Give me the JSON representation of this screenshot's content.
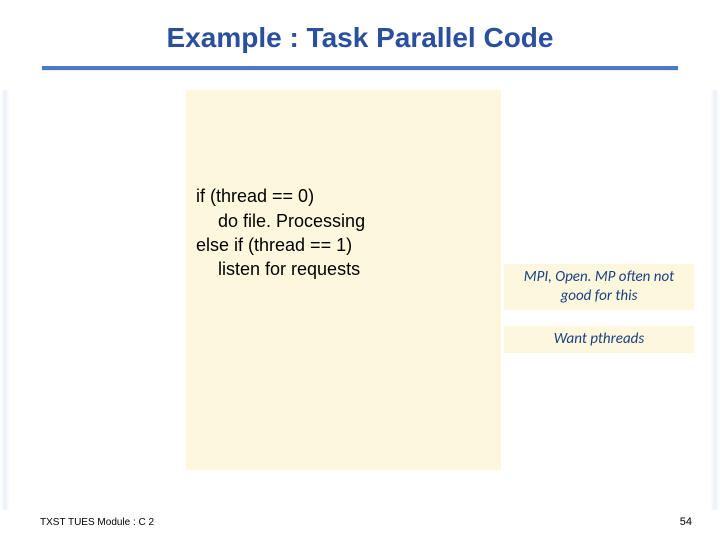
{
  "title": "Example : Task Parallel Code",
  "code": {
    "l1": "if (thread == 0)",
    "l2": "do file. Processing",
    "l3": "else if (thread == 1)",
    "l4": "listen for requests"
  },
  "notes": {
    "n1": "MPI, Open. MP often not good for this",
    "n2": "Want pthreads"
  },
  "footer": {
    "left": "TXST TUES Module : C 2",
    "page": "54"
  }
}
